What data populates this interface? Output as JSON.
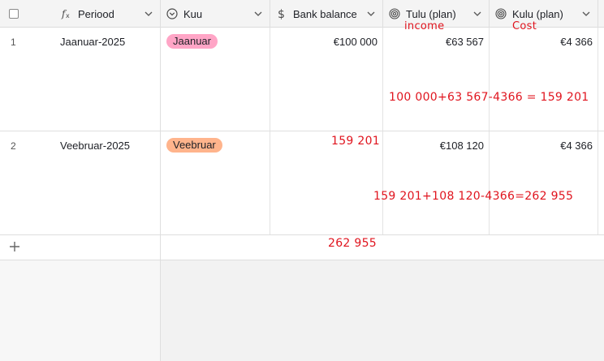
{
  "columns": [
    {
      "label": "Periood",
      "icon": "formula-icon"
    },
    {
      "label": "Kuu",
      "icon": "single-select-icon"
    },
    {
      "label": "Bank balance",
      "icon": "dollar-icon"
    },
    {
      "label": "Tulu (plan)",
      "icon": "rollup-icon"
    },
    {
      "label": "Kulu (plan)",
      "icon": "rollup-icon"
    }
  ],
  "rows": [
    {
      "num": "1",
      "periood": "Jaanuar-2025",
      "kuu": "Jaanuar",
      "kuu_color": "#ffa5c6",
      "bank": "€100 000",
      "tulu": "€63 567",
      "kulu": "€4 366"
    },
    {
      "num": "2",
      "periood": "Veebruar-2025",
      "kuu": "Veebruar",
      "kuu_color": "#ffb48c",
      "bank": "",
      "tulu": "€108 120",
      "kulu": "€4 366"
    }
  ],
  "annotations": {
    "income": "income",
    "cost": "Cost",
    "calc1": "100 000+63 567-4366 = 159 201",
    "result1": "159 201",
    "calc2": "159 201+108 120-4366=262 955",
    "result2": "262 955"
  },
  "colors": {
    "annotation": "#e0141e",
    "header_bg": "#f4f4f4"
  }
}
